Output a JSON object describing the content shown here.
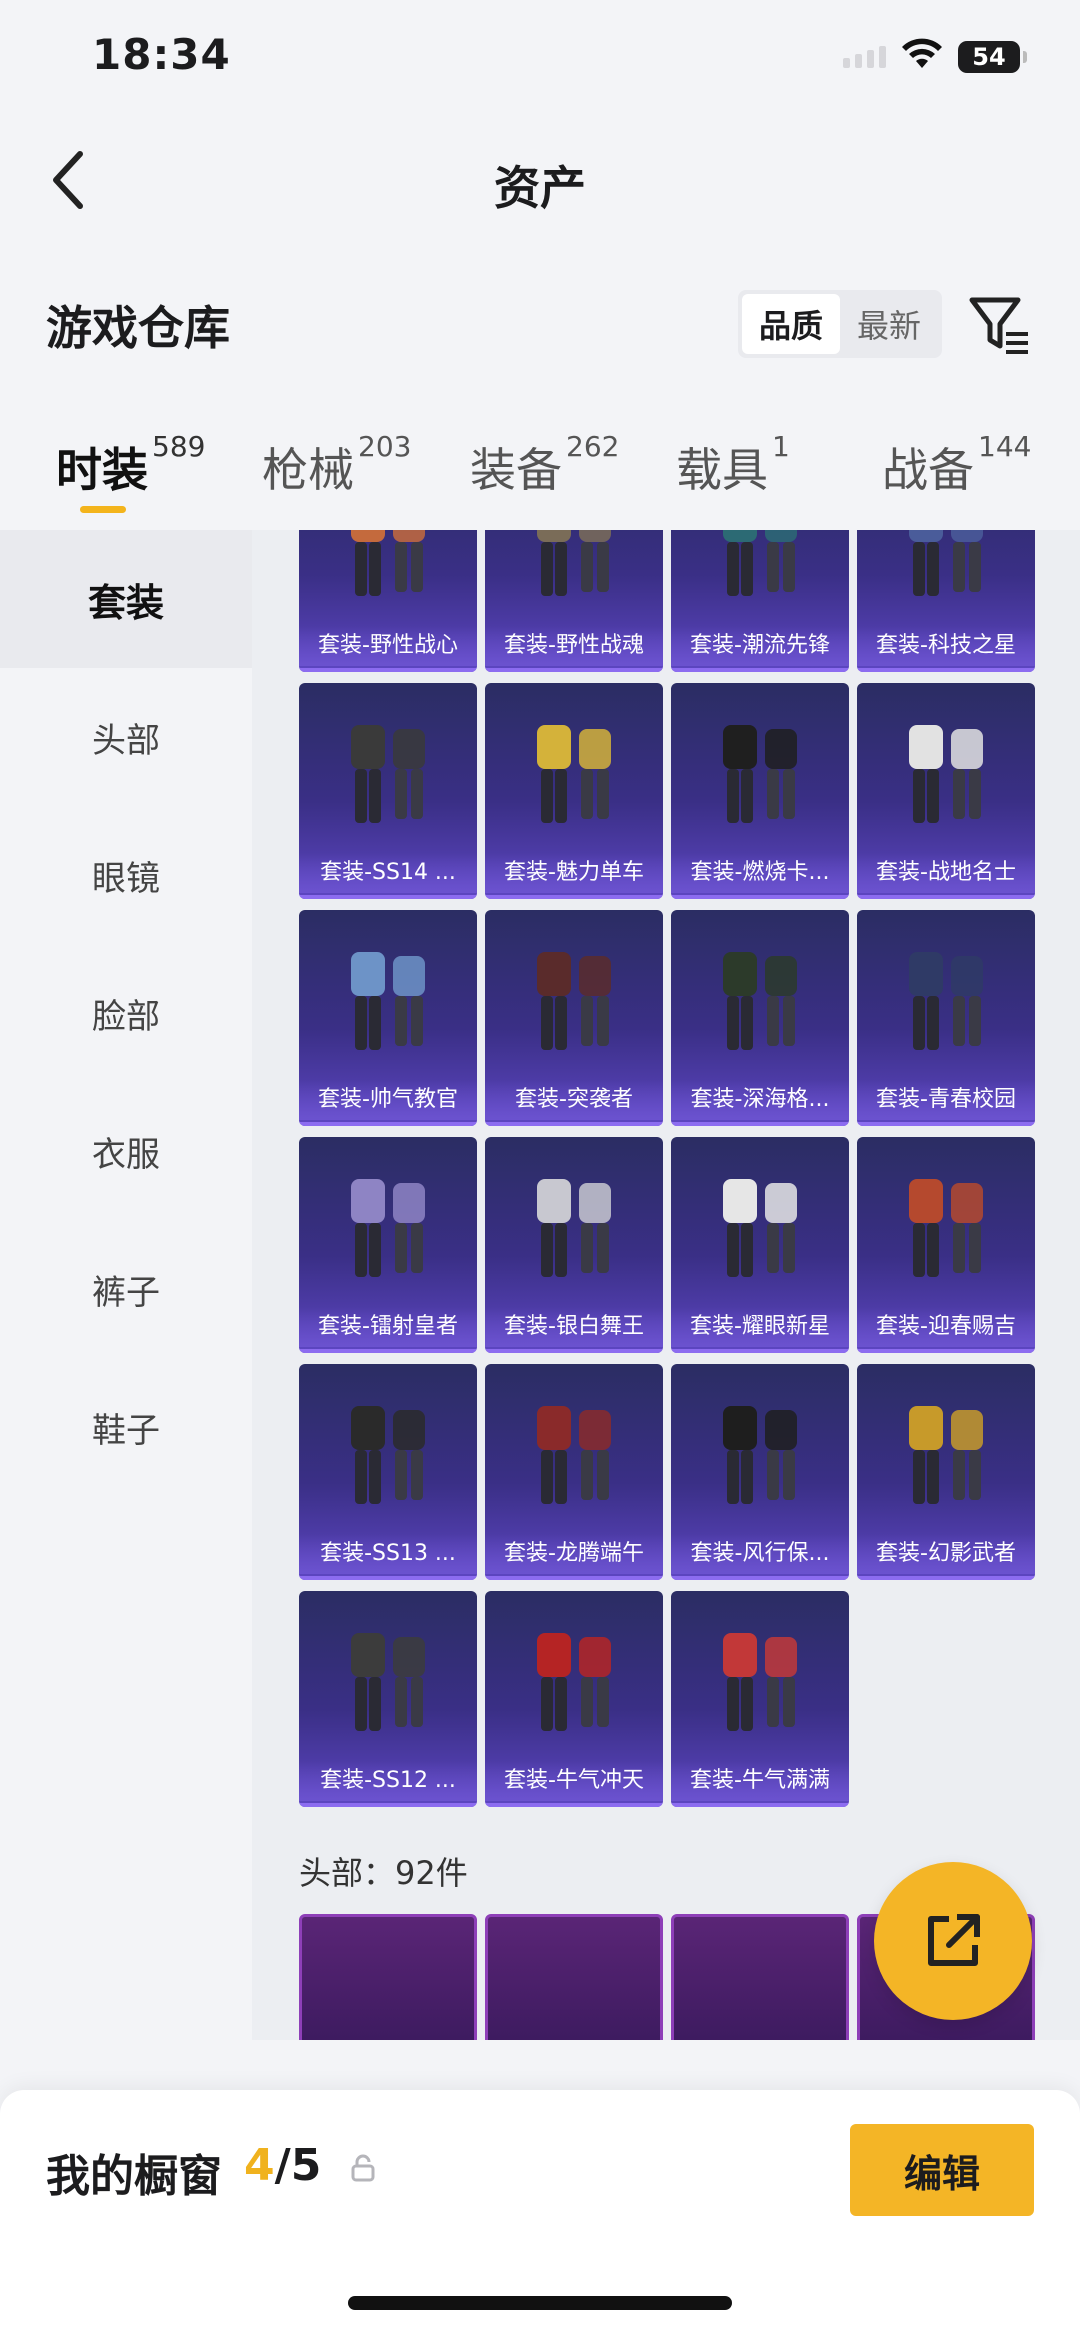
{
  "status": {
    "time": "18:34",
    "battery": "54"
  },
  "nav": {
    "title": "资产"
  },
  "warehouse": {
    "title": "游戏仓库",
    "sort_options": [
      "品质",
      "最新"
    ],
    "sort_active": 0
  },
  "tabs": [
    {
      "label": "时装",
      "count": "589"
    },
    {
      "label": "枪械",
      "count": "203"
    },
    {
      "label": "装备",
      "count": "262"
    },
    {
      "label": "载具",
      "count": "1"
    },
    {
      "label": "战备",
      "count": "144"
    }
  ],
  "sidebar": [
    "套装",
    "头部",
    "眼镜",
    "脸部",
    "衣服",
    "裤子",
    "鞋子"
  ],
  "outfits": [
    "套装-野性战心",
    "套装-野性战魂",
    "套装-潮流先锋",
    "套装-科技之星",
    "套装-SS14 ...",
    "套装-魅力单车",
    "套装-燃烧卡...",
    "套装-战地名士",
    "套装-帅气教官",
    "套装-突袭者",
    "套装-深海格...",
    "套装-青春校园",
    "套装-镭射皇者",
    "套装-银白舞王",
    "套装-耀眼新星",
    "套装-迎春赐吉",
    "套装-SS13 ...",
    "套装-龙腾端午",
    "套装-风行保...",
    "套装-幻影武者",
    "套装-SS12 ...",
    "套装-牛气冲天",
    "套装-牛气满满"
  ],
  "head_section": {
    "label": "头部：92件"
  },
  "showcase": {
    "title": "我的橱窗",
    "current": "4",
    "sep_total": "/5",
    "edit_label": "编辑"
  },
  "icons": {
    "back": "chevron-left-icon",
    "filter": "filter-icon",
    "share": "share-icon",
    "lock": "lock-icon"
  },
  "colors": {
    "accent": "#f4b526",
    "card_purple": "#3a2f86"
  }
}
